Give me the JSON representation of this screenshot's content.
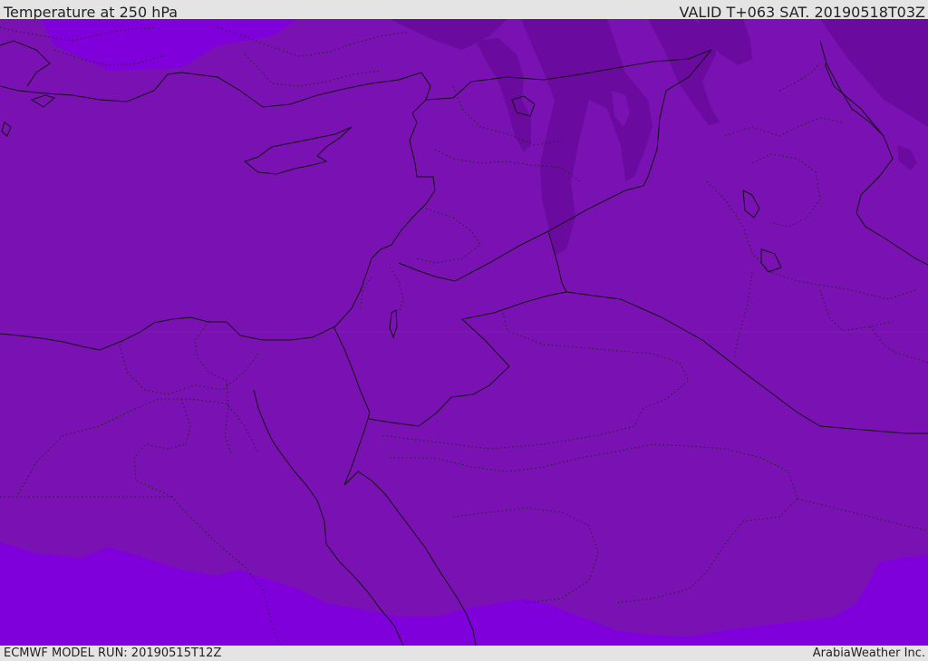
{
  "header": {
    "title": "Temperature at 250 hPa",
    "valid": "VALID T+063 SAT. 20190518T03Z"
  },
  "footer": {
    "model_run": "ECMWF MODEL RUN: 20190515T12Z",
    "credit": "ArabiaWeather Inc."
  },
  "colors": {
    "base_field": "#7a12b3",
    "warm_field": "#8000dc",
    "cold_field": "#6a0a9e",
    "coastline": "#111111"
  }
}
